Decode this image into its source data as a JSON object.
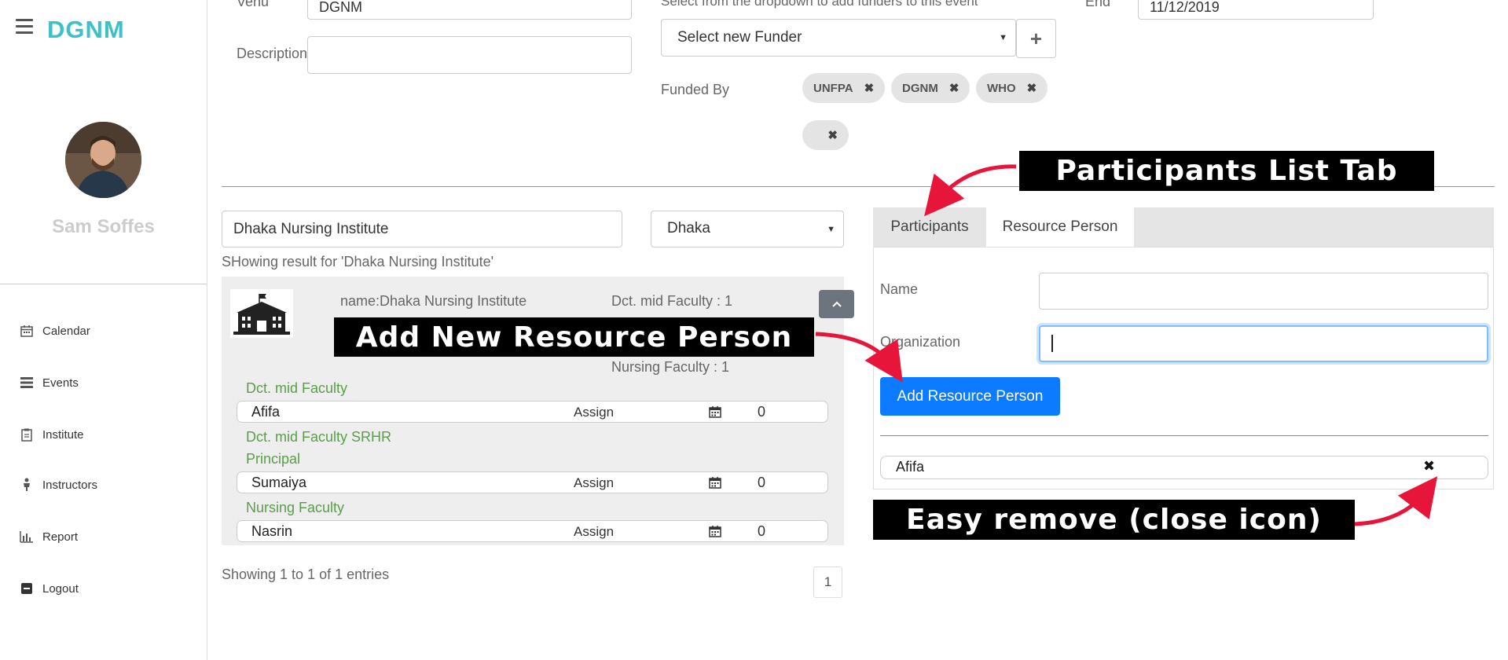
{
  "brand": "DGNM",
  "user": {
    "name": "Sam Soffes"
  },
  "nav": [
    {
      "label": "Calendar",
      "icon": "calendar-icon"
    },
    {
      "label": "Events",
      "icon": "list-icon"
    },
    {
      "label": "Institute",
      "icon": "clipboard-icon"
    },
    {
      "label": "Instructors",
      "icon": "person-icon"
    },
    {
      "label": "Report",
      "icon": "bar-chart-icon"
    },
    {
      "label": "Logout",
      "icon": "logout-icon"
    }
  ],
  "event_form": {
    "venue_label": "Venu",
    "venue_value": "DGNM",
    "description_label": "Description",
    "description_value": "",
    "funder_hint": "Select from the dropdown to add funders to this event",
    "funder_select": "Select new Funder",
    "funded_by_label": "Funded By",
    "funders": [
      "UNFPA",
      "DGNM",
      "WHO",
      ""
    ],
    "end_label": "End",
    "end_value": "11/12/2019"
  },
  "search": {
    "query": "Dhaka Nursing Institute",
    "district": "Dhaka",
    "result_text": "SHowing result for 'Dhaka Nursing Institute'"
  },
  "institute": {
    "name_line": "name:Dhaka Nursing Institute",
    "stat1": "Dct. mid Faculty : 1",
    "stat2": "Nursing Faculty : 1",
    "groups": [
      {
        "category": "Dct. mid Faculty",
        "people": [
          {
            "name": "Afifa",
            "action": "Assign",
            "count": "0"
          }
        ]
      },
      {
        "category": "Dct. mid Faculty SRHR",
        "people": []
      },
      {
        "category": "Principal",
        "people": [
          {
            "name": "Sumaiya",
            "action": "Assign",
            "count": "0"
          }
        ]
      },
      {
        "category": "Nursing Faculty",
        "people": [
          {
            "name": "Nasrin",
            "action": "Assign",
            "count": "0"
          }
        ]
      }
    ]
  },
  "pagination": {
    "info": "Showing 1 to 1 of 1 entries",
    "page": "1"
  },
  "resource_panel": {
    "tabs": [
      "Participants",
      "Resource Person"
    ],
    "active_tab": "Resource Person",
    "name_label": "Name",
    "name_value": "",
    "org_label": "Organization",
    "org_value": "",
    "add_button": "Add Resource Person",
    "assigned": [
      "Afifa"
    ]
  },
  "annotations": {
    "participants_tab": "Participants List Tab",
    "add_resource": "Add New Resource Person",
    "easy_remove": "Easy remove (close icon)"
  }
}
